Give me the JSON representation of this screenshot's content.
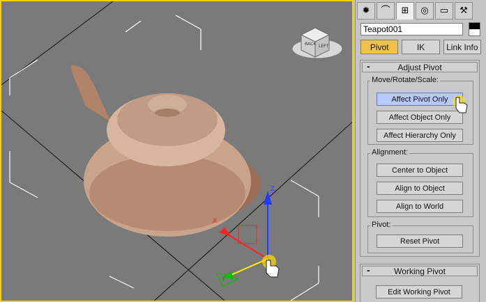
{
  "command_panel": {
    "tabs": [
      {
        "name": "create-icon",
        "glyph": "✹"
      },
      {
        "name": "modify-icon",
        "glyph": "⌒"
      },
      {
        "name": "hierarchy-icon",
        "glyph": "⊞"
      },
      {
        "name": "motion-icon",
        "glyph": "◎"
      },
      {
        "name": "display-icon",
        "glyph": "▭"
      },
      {
        "name": "utilities-icon",
        "glyph": "⚒"
      }
    ],
    "object_name": "Teapot001",
    "object_color": "#000000",
    "modes": [
      "Pivot",
      "IK",
      "Link Info"
    ],
    "active_mode": "Pivot"
  },
  "adjust_pivot": {
    "title": "Adjust Pivot",
    "collapse_symbol": "-",
    "move_rotate_scale": {
      "label": "Move/Rotate/Scale:",
      "buttons": [
        "Affect Pivot Only",
        "Affect Object Only",
        "Affect Hierarchy Only"
      ]
    },
    "alignment": {
      "label": "Alignment:",
      "buttons": [
        "Center to Object",
        "Align to Object",
        "Align to World"
      ]
    },
    "pivot": {
      "label": "Pivot:",
      "buttons": [
        "Reset Pivot"
      ]
    }
  },
  "working_pivot": {
    "title": "Working Pivot",
    "collapse_symbol": "-",
    "buttons": [
      "Edit Working Pivot"
    ]
  },
  "viewcube": {
    "faces": [
      "BACK",
      "LEFT"
    ]
  },
  "gizmo": {
    "axis_labels": [
      "Z",
      "X",
      "Y"
    ]
  },
  "colors": {
    "viewport_border": "#f3d200",
    "active_mode": "#f1c248",
    "active_button": "#b8c8ff",
    "teapot": "#c9a48a"
  }
}
